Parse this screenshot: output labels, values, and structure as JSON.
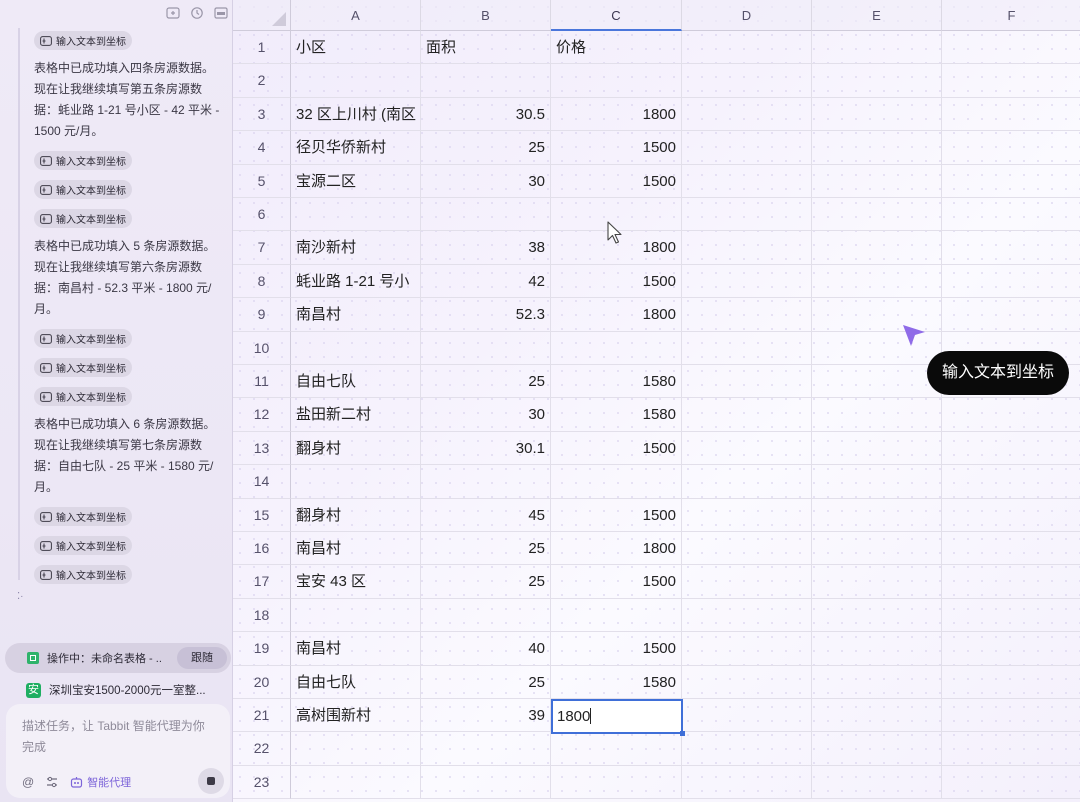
{
  "panel": {
    "feed": [
      {
        "type": "chip",
        "label": "输入文本到坐标"
      },
      {
        "type": "msg",
        "text": "表格中已成功填入四条房源数据。现在让我继续填写第五条房源数据：蚝业路 1-21 号小区 - 42 平米 - 1500 元/月。"
      },
      {
        "type": "chip",
        "label": "输入文本到坐标"
      },
      {
        "type": "chip",
        "label": "输入文本到坐标"
      },
      {
        "type": "chip",
        "label": "输入文本到坐标"
      },
      {
        "type": "msg",
        "text": "表格中已成功填入 5 条房源数据。现在让我继续填写第六条房源数据：南昌村 - 52.3 平米 - 1800 元/月。"
      },
      {
        "type": "chip",
        "label": "输入文本到坐标"
      },
      {
        "type": "chip",
        "label": "输入文本到坐标"
      },
      {
        "type": "chip",
        "label": "输入文本到坐标"
      },
      {
        "type": "msg",
        "text": "表格中已成功填入 6 条房源数据。现在让我继续填写第七条房源数据：自由七队 - 25 平米 - 1580 元/月。"
      },
      {
        "type": "chip",
        "label": "输入文本到坐标"
      },
      {
        "type": "chip",
        "label": "输入文本到坐标"
      },
      {
        "type": "chip",
        "label": "输入文本到坐标"
      }
    ],
    "task": {
      "label": "操作中：未命名表格 - ...",
      "follow": "跟随"
    },
    "tab": {
      "icon": "安",
      "label": "深圳宝安1500-2000元一室整..."
    },
    "composer": {
      "placeholder": "描述任务，让 Tabbit 智能代理为你完成",
      "agent_label": "智能代理"
    }
  },
  "sheet": {
    "columns": [
      "A",
      "B",
      "C",
      "D",
      "E",
      "F"
    ],
    "selected_column": "C",
    "rows": [
      [
        "小区",
        "面积",
        "价格"
      ],
      [
        "",
        "",
        ""
      ],
      [
        "32 区上川村 (南区",
        "30.5",
        "1800"
      ],
      [
        "径贝华侨新村",
        "25",
        "1500"
      ],
      [
        "宝源二区",
        "30",
        "1500"
      ],
      [
        "",
        "",
        ""
      ],
      [
        "南沙新村",
        "38",
        "1800"
      ],
      [
        "蚝业路 1-21 号小",
        "42",
        "1500"
      ],
      [
        "南昌村",
        "52.3",
        "1800"
      ],
      [
        "",
        "",
        ""
      ],
      [
        "自由七队",
        "25",
        "1580"
      ],
      [
        "盐田新二村",
        "30",
        "1580"
      ],
      [
        "翻身村",
        "30.1",
        "1500"
      ],
      [
        "",
        "",
        ""
      ],
      [
        "翻身村",
        "45",
        "1500"
      ],
      [
        "南昌村",
        "25",
        "1800"
      ],
      [
        "宝安 43 区",
        "25",
        "1500"
      ],
      [
        "",
        "",
        ""
      ],
      [
        "南昌村",
        "40",
        "1500"
      ],
      [
        "自由七队",
        "25",
        "1580"
      ],
      [
        "高树围新村",
        "39",
        ""
      ],
      [
        "",
        "",
        ""
      ],
      [
        "",
        "",
        ""
      ]
    ],
    "active_cell": {
      "ref": "C21",
      "value": "1800"
    },
    "tooltip": "输入文本到坐标",
    "accent": "#3f6fd8",
    "ai_cursor_color": "#8f6be8"
  }
}
